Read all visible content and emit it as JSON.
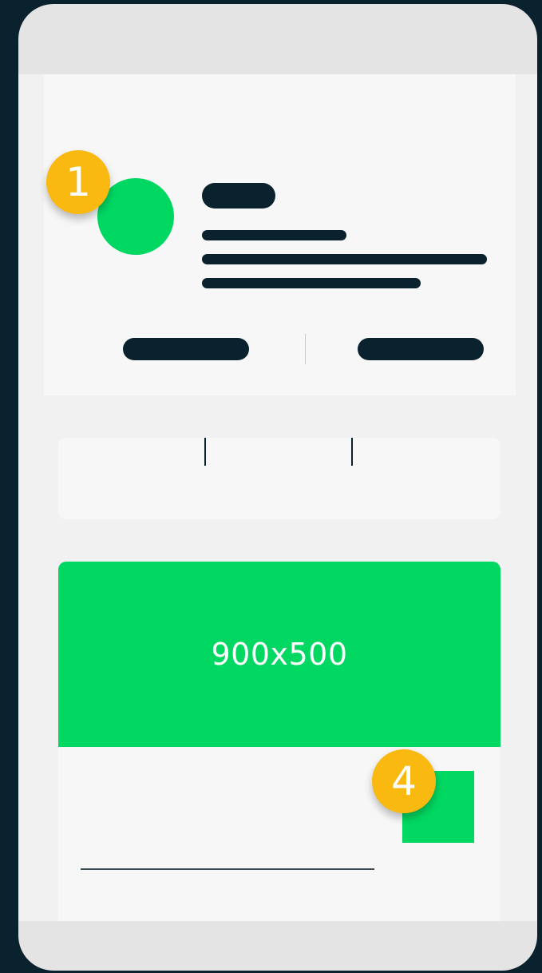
{
  "media": {
    "image_label": "900x500"
  },
  "badges": {
    "badge_1": "1",
    "badge_4": "4"
  },
  "colors": {
    "background": "#0a222e",
    "accent_green": "#00d862",
    "badge_yellow": "#f9b911",
    "card": "#f7f7f7",
    "frame": "#e4e4e4"
  },
  "icons": {
    "avatar": "avatar-circle",
    "thumbnail": "image-placeholder"
  }
}
